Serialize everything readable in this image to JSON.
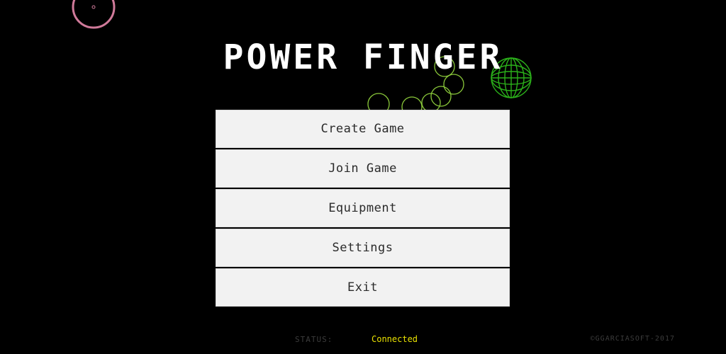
{
  "game": {
    "title": "POWER FINGER"
  },
  "menu": {
    "items": [
      {
        "id": "create-game",
        "label": "Create Game"
      },
      {
        "id": "join-game",
        "label": "Join Game"
      },
      {
        "id": "equipment",
        "label": "Equipment"
      },
      {
        "id": "settings",
        "label": "Settings"
      },
      {
        "id": "exit",
        "label": "Exit"
      }
    ]
  },
  "status": {
    "label": "STATUS:",
    "value": "Connected"
  },
  "footer": {
    "copyright": "©GGARCIASOFT-2017"
  },
  "colors": {
    "background": "#000000",
    "title": "#ffffff",
    "button_bg": "#f2f2f2",
    "button_text": "#2b2b2b",
    "status_value": "#e8e000",
    "muted_text": "#3c3c3c",
    "bubble_green": "#8ac83a",
    "sphere_green": "#2bb01a",
    "ring_pink": "#d07a9a"
  },
  "icons": {
    "decorations": [
      "pink-ring-icon",
      "green-bubbles-icon",
      "green-wireframe-sphere-icon"
    ]
  }
}
